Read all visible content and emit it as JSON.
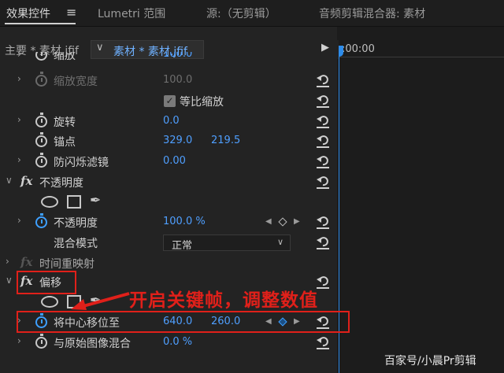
{
  "tabs": [
    {
      "label": "效果控件",
      "active": true
    },
    {
      "label": "Lumetri 范围",
      "active": false
    },
    {
      "label": "源:（无剪辑）",
      "active": false
    },
    {
      "label": "音频剪辑混合器: 素材",
      "active": false
    }
  ],
  "tab_menu_icon": "hamburger-menu-icon",
  "sequence_bar": {
    "master_label": "主要 * 素材.jfif",
    "sequence_label": "素材 * 素材.jfif",
    "timecode": ":00:00"
  },
  "properties": {
    "scale": {
      "label": "缩放",
      "value": "100.0"
    },
    "scale_width": {
      "label": "缩放宽度",
      "value": "100.0"
    },
    "uniform_scale": {
      "label": "等比缩放",
      "checked": true
    },
    "rotation": {
      "label": "旋转",
      "value": "0.0"
    },
    "anchor": {
      "label": "锚点",
      "x": "329.0",
      "y": "219.5"
    },
    "anti_flicker": {
      "label": "防闪烁滤镜",
      "value": "0.00"
    },
    "opacity_section": {
      "label": "不透明度"
    },
    "opacity": {
      "label": "不透明度",
      "value": "100.0 %"
    },
    "blend_mode": {
      "label": "混合模式",
      "value": "正常"
    },
    "time_remap": {
      "label": "时间重映射"
    },
    "offset_section": {
      "label": "偏移"
    },
    "shift_center": {
      "label": "将中心移位至",
      "x": "640.0",
      "y": "260.0"
    },
    "blend_original": {
      "label": "与原始图像混合",
      "value": "0.0 %"
    }
  },
  "fx_label": "fx",
  "annotation": {
    "text": "开启关键帧，调整数值",
    "color": "#e0201a"
  },
  "watermark": "百家号/小晨Pr剪辑",
  "colors": {
    "accent": "#3ea0ff",
    "value_blue": "#4f9fff",
    "annotation_red": "#e0201a",
    "playhead": "#2d8ceb"
  }
}
